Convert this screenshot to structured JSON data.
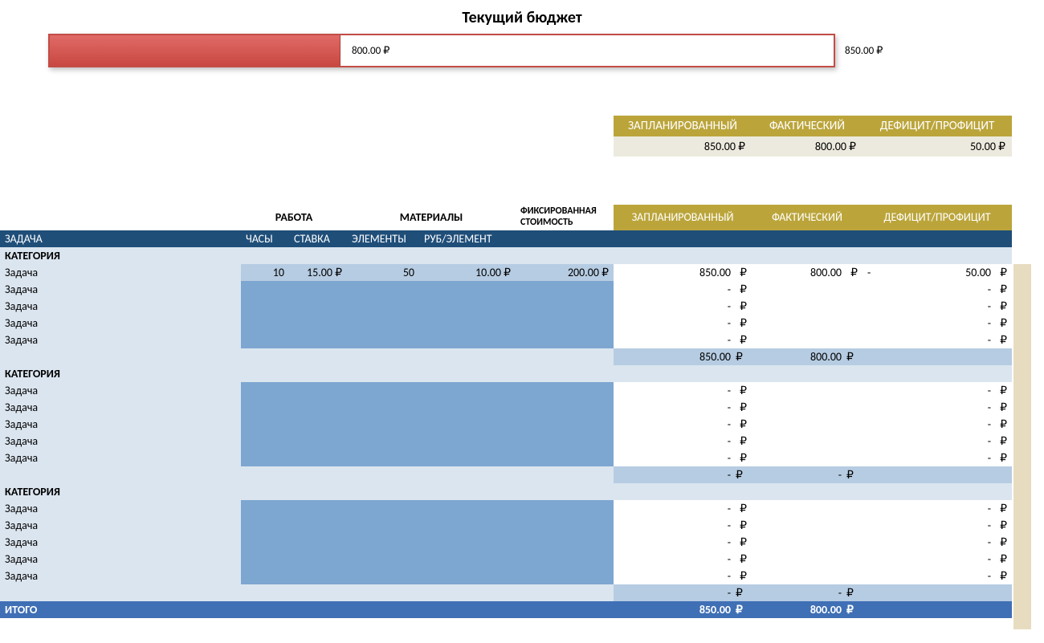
{
  "title": "Текущий бюджет",
  "currency": "₽",
  "progress": {
    "actual_label": "800.00 ₽",
    "planned_label": "850.00 ₽"
  },
  "summary": {
    "headers": {
      "planned": "ЗАПЛАНИРОВАННЫЙ",
      "actual": "ФАКТИЧЕСКИЙ",
      "diff": "ДЕФИЦИТ/ПРОФИЦИТ"
    },
    "values": {
      "planned": "850.00 ₽",
      "actual": "800.00 ₽",
      "diff": "50.00 ₽"
    }
  },
  "grid": {
    "group_headers": {
      "work": "РАБОТА",
      "materials": "МАТЕРИАЛЫ",
      "fixed": "ФИКСИРОВАННАЯ СТОИМОСТЬ",
      "planned": "ЗАПЛАНИРОВАННЫЙ",
      "actual": "ФАКТИЧЕСКИЙ",
      "diff": "ДЕФИЦИТ/ПРОФИЦИТ"
    },
    "sub_headers": {
      "task": "ЗАДАЧА",
      "hours": "ЧАСЫ",
      "rate": "СТАВКА",
      "items": "ЭЛЕМЕНТЫ",
      "per": "РУБ/ЭЛЕМЕНТ"
    },
    "category_label": "КАТЕГОРИЯ",
    "task_label": "Задача",
    "total_label": "ИТОГО",
    "categories": [
      {
        "tasks": [
          {
            "hours": "10",
            "rate": "15.00 ₽",
            "items": "50",
            "per": "10.00 ₽",
            "fixed": "200.00 ₽",
            "planned": {
              "n": "850.00",
              "r": "₽"
            },
            "actual": {
              "n": "800.00",
              "r": "₽"
            },
            "diff": {
              "pre": "-",
              "n": "50.00",
              "r": "₽"
            }
          },
          {
            "planned": {
              "n": "-",
              "r": "₽"
            },
            "diff": {
              "n": "-",
              "r": "₽"
            }
          },
          {
            "planned": {
              "n": "-",
              "r": "₽"
            },
            "diff": {
              "n": "-",
              "r": "₽"
            }
          },
          {
            "planned": {
              "n": "-",
              "r": "₽"
            },
            "diff": {
              "n": "-",
              "r": "₽"
            }
          },
          {
            "planned": {
              "n": "-",
              "r": "₽"
            },
            "diff": {
              "n": "-",
              "r": "₽"
            }
          }
        ],
        "subtotal": {
          "planned": {
            "n": "850.00",
            "r": "₽"
          },
          "actual": {
            "n": "800.00",
            "r": "₽"
          }
        }
      },
      {
        "tasks": [
          {
            "planned": {
              "n": "-",
              "r": "₽"
            },
            "diff": {
              "n": "-",
              "r": "₽"
            }
          },
          {
            "planned": {
              "n": "-",
              "r": "₽"
            },
            "diff": {
              "n": "-",
              "r": "₽"
            }
          },
          {
            "planned": {
              "n": "-",
              "r": "₽"
            },
            "diff": {
              "n": "-",
              "r": "₽"
            }
          },
          {
            "planned": {
              "n": "-",
              "r": "₽"
            },
            "diff": {
              "n": "-",
              "r": "₽"
            }
          },
          {
            "planned": {
              "n": "-",
              "r": "₽"
            },
            "diff": {
              "n": "-",
              "r": "₽"
            }
          }
        ],
        "subtotal": {
          "planned": {
            "n": "-",
            "r": "₽"
          },
          "actual": {
            "n": "-",
            "r": "₽"
          }
        }
      },
      {
        "tasks": [
          {
            "planned": {
              "n": "-",
              "r": "₽"
            },
            "diff": {
              "n": "-",
              "r": "₽"
            }
          },
          {
            "planned": {
              "n": "-",
              "r": "₽"
            },
            "diff": {
              "n": "-",
              "r": "₽"
            }
          },
          {
            "planned": {
              "n": "-",
              "r": "₽"
            },
            "diff": {
              "n": "-",
              "r": "₽"
            }
          },
          {
            "planned": {
              "n": "-",
              "r": "₽"
            },
            "diff": {
              "n": "-",
              "r": "₽"
            }
          },
          {
            "planned": {
              "n": "-",
              "r": "₽"
            },
            "diff": {
              "n": "-",
              "r": "₽"
            }
          }
        ],
        "subtotal": {
          "planned": {
            "n": "-",
            "r": "₽"
          },
          "actual": {
            "n": "-",
            "r": "₽"
          }
        }
      }
    ],
    "total": {
      "planned": {
        "n": "850.00",
        "r": "₽"
      },
      "actual": {
        "n": "800.00",
        "r": "₽"
      }
    }
  }
}
